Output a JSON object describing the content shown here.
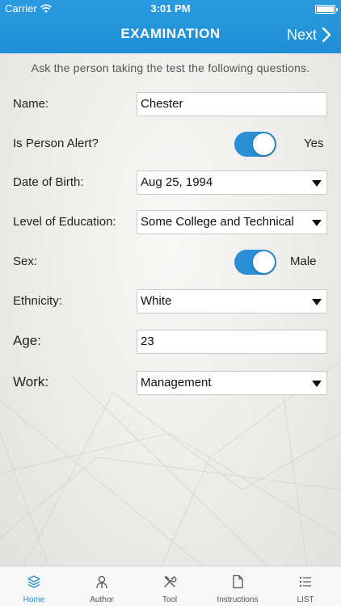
{
  "status_bar": {
    "carrier": "Carrier",
    "time": "3:01 PM"
  },
  "nav": {
    "title": "EXAMINATION",
    "next_label": "Next"
  },
  "intro": "Ask the person taking the test the following questions.",
  "form": {
    "name": {
      "label": "Name:",
      "value": "Chester"
    },
    "alert": {
      "label": "Is Person Alert?",
      "state": "Yes",
      "on": true
    },
    "dob": {
      "label": "Date of Birth:",
      "value": "Aug 25, 1994"
    },
    "education": {
      "label": "Level of Education:",
      "value": "Some College and Technical"
    },
    "sex": {
      "label": "Sex:",
      "state": "Male",
      "on": true
    },
    "ethnicity": {
      "label": "Ethnicity:",
      "value": "White"
    },
    "age": {
      "label": "Age:",
      "value": "23"
    },
    "work": {
      "label": "Work:",
      "value": "Management"
    }
  },
  "tabs": [
    {
      "label": "Home",
      "icon": "layers-icon",
      "active": true
    },
    {
      "label": "Author",
      "icon": "person-icon",
      "active": false
    },
    {
      "label": "Tool",
      "icon": "tools-icon",
      "active": false
    },
    {
      "label": "Instructions",
      "icon": "document-icon",
      "active": false
    },
    {
      "label": "LIST",
      "icon": "list-icon",
      "active": false
    }
  ],
  "colors": {
    "accent": "#2a8fd4",
    "header": "#1f8ed6"
  }
}
